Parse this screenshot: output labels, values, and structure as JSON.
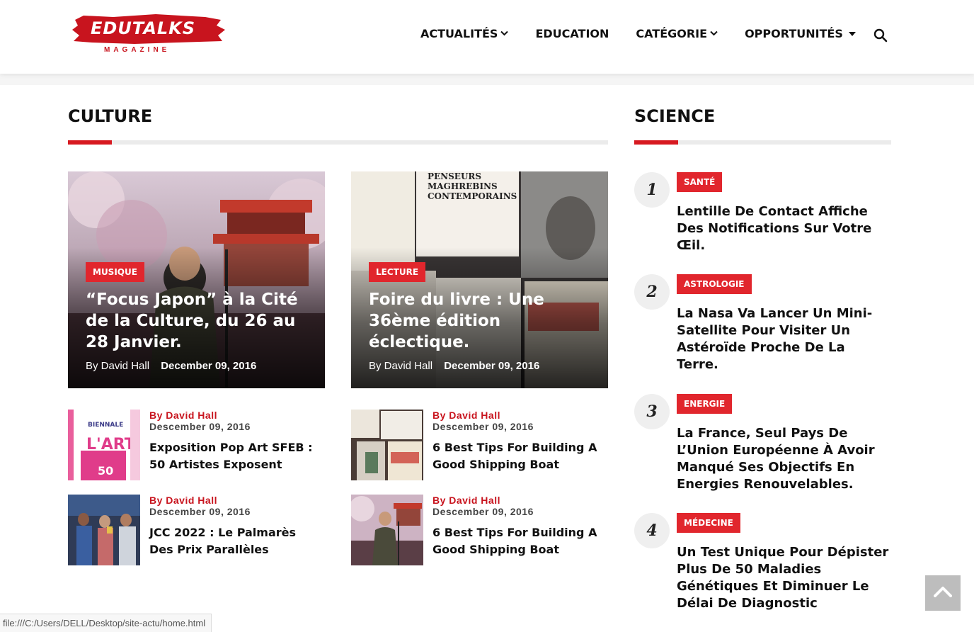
{
  "header": {
    "logo_text": "EDUTALKS",
    "logo_sub": "MAGAZINE",
    "nav": [
      {
        "label": "ACTUALITÉS",
        "indicator": "chevron"
      },
      {
        "label": "EDUCATION",
        "indicator": "none"
      },
      {
        "label": "CATÉGORIE",
        "indicator": "chevron"
      },
      {
        "label": "OPPORTUNITÉS",
        "indicator": "caret"
      }
    ],
    "search_icon": "search-icon"
  },
  "culture": {
    "title": "CULTURE",
    "featured": [
      {
        "badge": "MUSIQUE",
        "title": "“Focus Japon” à la Cité de la Culture, du 26 au 28 Janvier.",
        "author": "By David Hall",
        "date": "December 09, 2016"
      },
      {
        "badge": "LECTURE",
        "title": "Foire du livre : Une 36ème édition éclectique.",
        "author": "By David Hall",
        "date": "December 09, 2016"
      }
    ],
    "small": [
      {
        "author": "By David Hall",
        "date": "Descember 09, 2016",
        "title": "Exposition Pop Art SFEB : 50 Artistes Exposent"
      },
      {
        "author": "By David Hall",
        "date": "Descember 09, 2016",
        "title": "6 Best Tips For Building A Good Shipping Boat"
      },
      {
        "author": "By David Hall",
        "date": "Descember 09, 2016",
        "title": "JCC 2022 : Le Palmarès Des Prix Parallèles"
      },
      {
        "author": "By David Hall",
        "date": "Descember 09, 2016",
        "title": "6 Best Tips For Building A Good Shipping Boat"
      }
    ]
  },
  "science": {
    "title": "SCIENCE",
    "items": [
      {
        "num": "1",
        "badge": "SANTÉ",
        "title": "Lentille De Contact Affiche Des Notifications Sur Votre Œil."
      },
      {
        "num": "2",
        "badge": "ASTROLOGIE",
        "title": "La Nasa Va Lancer Un Mini-Satellite Pour Visiter Un Astéroïde Proche De La Terre."
      },
      {
        "num": "3",
        "badge": "ENERGIE",
        "title": "La France, Seul Pays De L’Union Européenne À Avoir Manqué Ses Objectifs En Energies Renouvelables."
      },
      {
        "num": "4",
        "badge": "MÉDECINE",
        "title": "Un Test Unique Pour Dépister Plus De 50 Maladies Génétiques Et Diminuer Le Délai De Diagnostic"
      }
    ]
  },
  "status_url": "file:///C:/Users/DELL/Desktop/site-actu/home.html",
  "colors": {
    "accent": "#d71920",
    "badge": "#e1262d"
  }
}
